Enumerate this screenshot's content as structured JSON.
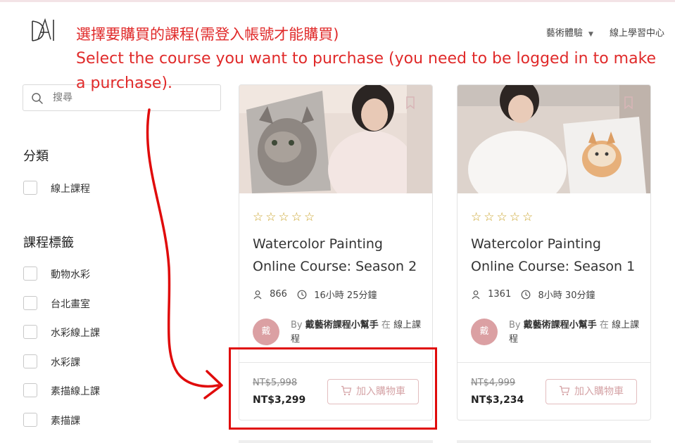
{
  "header": {
    "nav_art": "藝術體驗",
    "nav_online": "線上學習中心"
  },
  "annotation": {
    "zh": "選擇要購買的課程(需登入帳號才能購買)",
    "en": "Select the course you want to purchase (you need to be logged in to make a purchase)."
  },
  "search": {
    "placeholder": "搜尋"
  },
  "sidebar": {
    "category_title": "分類",
    "categories": [
      "線上課程"
    ],
    "tags_title": "課程標籤",
    "tags": [
      "動物水彩",
      "台北畫室",
      "水彩線上課",
      "水彩課",
      "素描線上課",
      "素描課"
    ]
  },
  "courses": [
    {
      "title": "Watercolor Painting Online Course: Season 2",
      "students": "866",
      "duration": "16小時 25分鐘",
      "avatar_text": "戴",
      "by": "By",
      "author": "戴藝術課程小幫手",
      "in": "在",
      "category": "線上課程",
      "old_price": "NT$5,998",
      "price": "NT$3,299",
      "cart_label": "加入購物車",
      "rating": 0
    },
    {
      "title": "Watercolor Painting Online Course: Season 1",
      "students": "1361",
      "duration": "8小時 30分鐘",
      "avatar_text": "戴",
      "by": "By",
      "author": "戴藝術課程小幫手",
      "in": "在",
      "category": "線上課程",
      "old_price": "NT$4,999",
      "price": "NT$3,234",
      "cart_label": "加入購物車",
      "rating": 0
    }
  ],
  "icons": {
    "logo": "brand-logo",
    "search": "search-icon",
    "bookmark": "bookmark-icon",
    "user": "user-icon",
    "clock": "clock-icon",
    "cart": "cart-icon",
    "star": "star-outline-icon"
  },
  "colors": {
    "annotation": "#e02a2a",
    "star": "#c9a227",
    "avatar": "#dba0a3",
    "cart_button": "#d5a3a6"
  }
}
